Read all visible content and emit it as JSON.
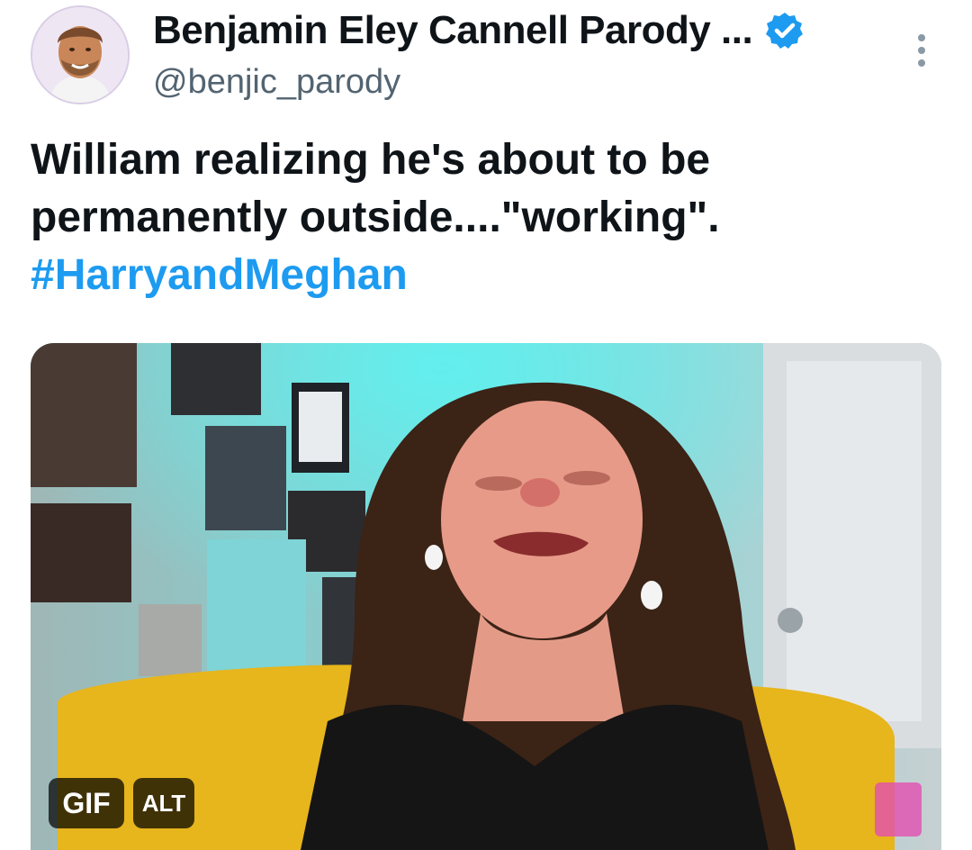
{
  "author": {
    "display_name": "Benjamin Eley Cannell Parody ...",
    "handle": "@benjic_parody",
    "verified": true,
    "verified_color": "#1d9bf0"
  },
  "tweet": {
    "text_line1": "William realizing he's about to be",
    "text_line2": "permanently outside....\"working\".",
    "hashtag": "#HarryandMeghan"
  },
  "media": {
    "gif_label": "GIF",
    "alt_label": "ALT"
  },
  "icons": [
    "verified-badge-icon",
    "more-options-icon"
  ],
  "colors": {
    "link": "#1d9bf0",
    "text": "#0f1419",
    "secondary": "#536471"
  }
}
